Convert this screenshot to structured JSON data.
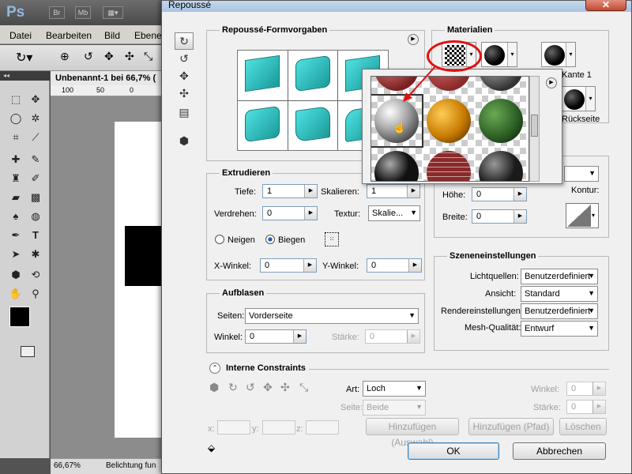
{
  "ps": {
    "logo": "Ps",
    "app_buttons": [
      "Br",
      "Mb"
    ],
    "menu": [
      "Datei",
      "Bearbeiten",
      "Bild",
      "Ebene"
    ],
    "doc_tab": "Unbenannt-1 bei 66,7% (",
    "ruler_labels": [
      "100",
      "50",
      "0"
    ],
    "zoom": "66,67%",
    "status": "Belichtung fun"
  },
  "dialog": {
    "title": "Repoussé",
    "close": "✕",
    "presets": {
      "title": "Repoussé-Formvorgaben"
    },
    "materials": {
      "title": "Materialien",
      "front_bevel_label": "Kante 1",
      "back_label": "Rückseite"
    },
    "extrude": {
      "title": "Extrudieren",
      "depth_label": "Tiefe:",
      "depth_value": "1",
      "scale_label": "Skalieren:",
      "scale_value": "1",
      "twist_label": "Verdrehen:",
      "twist_value": "0",
      "texture_label": "Textur:",
      "texture_value": "Skalie...",
      "tilt_label": "Neigen",
      "bend_label": "Biegen",
      "xangle_label": "X-Winkel:",
      "xangle_value": "0",
      "yangle_label": "Y-Winkel:",
      "yangle_value": "0"
    },
    "bevel": {
      "height_label": "Höhe:",
      "height_value": "0",
      "width_label": "Breite:",
      "width_value": "0",
      "contour_label": "Kontur:"
    },
    "inflate": {
      "title": "Aufblasen",
      "sides_label": "Seiten:",
      "sides_value": "Vorderseite",
      "angle_label": "Winkel:",
      "angle_value": "0",
      "strength_label": "Stärke:",
      "strength_value": "0"
    },
    "scene": {
      "title": "Szeneneinstellungen",
      "lights_label": "Lichtquellen:",
      "lights_value": "Benutzerdefiniert",
      "view_label": "Ansicht:",
      "view_value": "Standard",
      "render_label": "Rendereinstellungen:",
      "render_value": "Benutzerdefiniert",
      "mesh_label": "Mesh-Qualität:",
      "mesh_value": "Entwurf"
    },
    "constraints": {
      "title": "Interne Constraints",
      "type_label": "Art:",
      "type_value": "Loch",
      "side_label": "Seite:",
      "side_value": "Beide",
      "angle_label": "Winkel:",
      "angle_value": "0",
      "strength_label": "Stärke:",
      "strength_value": "0",
      "x_label": "x:",
      "y_label": "y:",
      "z_label": "z:",
      "add_selection": "Hinzufügen (Auswahl)",
      "add_path": "Hinzufügen (Pfad)",
      "delete": "Löschen"
    },
    "ok": "OK",
    "cancel": "Abbrechen"
  }
}
